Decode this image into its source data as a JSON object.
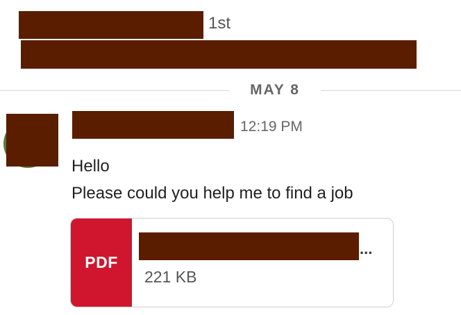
{
  "header": {
    "degree": "1st"
  },
  "divider": {
    "date": "MAY 8"
  },
  "message": {
    "time": "12:19 PM",
    "lines": [
      "Hello",
      "Please could you help me to find a job"
    ]
  },
  "attachment": {
    "type_label": "PDF",
    "name_overflow": "...",
    "size": "221 KB",
    "badge_color": "#d0162f"
  },
  "colors": {
    "redaction": "#5a1d00",
    "divider": "#d6d6d6"
  }
}
